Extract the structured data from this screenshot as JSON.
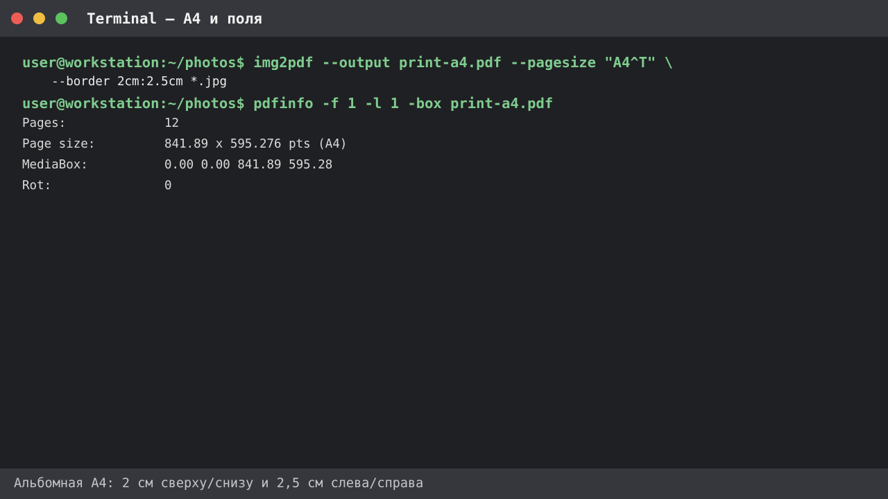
{
  "window": {
    "title": "Terminal — A4 и поля",
    "traffic_lights": {
      "close_color": "#ee5d55",
      "minimize_color": "#f1be42",
      "maximize_color": "#5cc35f"
    }
  },
  "terminal": {
    "prompt_color": "#7fcc8f",
    "lines": [
      {
        "kind": "prompt",
        "text": "user@workstation:~/photos$ img2pdf --output print-a4.pdf --pagesize \"A4^T\" \\"
      },
      {
        "kind": "continuation",
        "text": "    --border 2cm:2.5cm *.jpg"
      },
      {
        "kind": "prompt",
        "text": "user@workstation:~/photos$ pdfinfo -f 1 -l 1 -box print-a4.pdf"
      }
    ],
    "output": [
      {
        "key": "Pages:",
        "value": "12"
      },
      {
        "key": "Page size:",
        "value": "841.89 x 595.276 pts (A4)"
      },
      {
        "key": "MediaBox:",
        "value": "0.00 0.00 841.89 595.28"
      },
      {
        "key": "Rot:",
        "value": "0"
      }
    ]
  },
  "statusbar": {
    "text": "Альбомная A4: 2 см сверху/снизу и 2,5 см слева/справа"
  }
}
